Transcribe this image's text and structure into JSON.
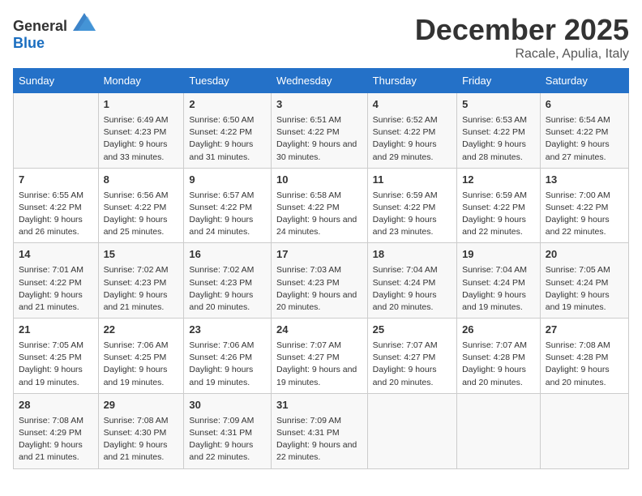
{
  "logo": {
    "general": "General",
    "blue": "Blue"
  },
  "header": {
    "month": "December 2025",
    "location": "Racale, Apulia, Italy"
  },
  "weekdays": [
    "Sunday",
    "Monday",
    "Tuesday",
    "Wednesday",
    "Thursday",
    "Friday",
    "Saturday"
  ],
  "weeks": [
    [
      {
        "day": null
      },
      {
        "day": 1,
        "sunrise": "6:49 AM",
        "sunset": "4:23 PM",
        "daylight": "9 hours and 33 minutes."
      },
      {
        "day": 2,
        "sunrise": "6:50 AM",
        "sunset": "4:22 PM",
        "daylight": "9 hours and 31 minutes."
      },
      {
        "day": 3,
        "sunrise": "6:51 AM",
        "sunset": "4:22 PM",
        "daylight": "9 hours and 30 minutes."
      },
      {
        "day": 4,
        "sunrise": "6:52 AM",
        "sunset": "4:22 PM",
        "daylight": "9 hours and 29 minutes."
      },
      {
        "day": 5,
        "sunrise": "6:53 AM",
        "sunset": "4:22 PM",
        "daylight": "9 hours and 28 minutes."
      },
      {
        "day": 6,
        "sunrise": "6:54 AM",
        "sunset": "4:22 PM",
        "daylight": "9 hours and 27 minutes."
      }
    ],
    [
      {
        "day": 7,
        "sunrise": "6:55 AM",
        "sunset": "4:22 PM",
        "daylight": "9 hours and 26 minutes."
      },
      {
        "day": 8,
        "sunrise": "6:56 AM",
        "sunset": "4:22 PM",
        "daylight": "9 hours and 25 minutes."
      },
      {
        "day": 9,
        "sunrise": "6:57 AM",
        "sunset": "4:22 PM",
        "daylight": "9 hours and 24 minutes."
      },
      {
        "day": 10,
        "sunrise": "6:58 AM",
        "sunset": "4:22 PM",
        "daylight": "9 hours and 24 minutes."
      },
      {
        "day": 11,
        "sunrise": "6:59 AM",
        "sunset": "4:22 PM",
        "daylight": "9 hours and 23 minutes."
      },
      {
        "day": 12,
        "sunrise": "6:59 AM",
        "sunset": "4:22 PM",
        "daylight": "9 hours and 22 minutes."
      },
      {
        "day": 13,
        "sunrise": "7:00 AM",
        "sunset": "4:22 PM",
        "daylight": "9 hours and 22 minutes."
      }
    ],
    [
      {
        "day": 14,
        "sunrise": "7:01 AM",
        "sunset": "4:22 PM",
        "daylight": "9 hours and 21 minutes."
      },
      {
        "day": 15,
        "sunrise": "7:02 AM",
        "sunset": "4:23 PM",
        "daylight": "9 hours and 21 minutes."
      },
      {
        "day": 16,
        "sunrise": "7:02 AM",
        "sunset": "4:23 PM",
        "daylight": "9 hours and 20 minutes."
      },
      {
        "day": 17,
        "sunrise": "7:03 AM",
        "sunset": "4:23 PM",
        "daylight": "9 hours and 20 minutes."
      },
      {
        "day": 18,
        "sunrise": "7:04 AM",
        "sunset": "4:24 PM",
        "daylight": "9 hours and 20 minutes."
      },
      {
        "day": 19,
        "sunrise": "7:04 AM",
        "sunset": "4:24 PM",
        "daylight": "9 hours and 19 minutes."
      },
      {
        "day": 20,
        "sunrise": "7:05 AM",
        "sunset": "4:24 PM",
        "daylight": "9 hours and 19 minutes."
      }
    ],
    [
      {
        "day": 21,
        "sunrise": "7:05 AM",
        "sunset": "4:25 PM",
        "daylight": "9 hours and 19 minutes."
      },
      {
        "day": 22,
        "sunrise": "7:06 AM",
        "sunset": "4:25 PM",
        "daylight": "9 hours and 19 minutes."
      },
      {
        "day": 23,
        "sunrise": "7:06 AM",
        "sunset": "4:26 PM",
        "daylight": "9 hours and 19 minutes."
      },
      {
        "day": 24,
        "sunrise": "7:07 AM",
        "sunset": "4:27 PM",
        "daylight": "9 hours and 19 minutes."
      },
      {
        "day": 25,
        "sunrise": "7:07 AM",
        "sunset": "4:27 PM",
        "daylight": "9 hours and 20 minutes."
      },
      {
        "day": 26,
        "sunrise": "7:07 AM",
        "sunset": "4:28 PM",
        "daylight": "9 hours and 20 minutes."
      },
      {
        "day": 27,
        "sunrise": "7:08 AM",
        "sunset": "4:28 PM",
        "daylight": "9 hours and 20 minutes."
      }
    ],
    [
      {
        "day": 28,
        "sunrise": "7:08 AM",
        "sunset": "4:29 PM",
        "daylight": "9 hours and 21 minutes."
      },
      {
        "day": 29,
        "sunrise": "7:08 AM",
        "sunset": "4:30 PM",
        "daylight": "9 hours and 21 minutes."
      },
      {
        "day": 30,
        "sunrise": "7:09 AM",
        "sunset": "4:31 PM",
        "daylight": "9 hours and 22 minutes."
      },
      {
        "day": 31,
        "sunrise": "7:09 AM",
        "sunset": "4:31 PM",
        "daylight": "9 hours and 22 minutes."
      },
      {
        "day": null
      },
      {
        "day": null
      },
      {
        "day": null
      }
    ]
  ]
}
